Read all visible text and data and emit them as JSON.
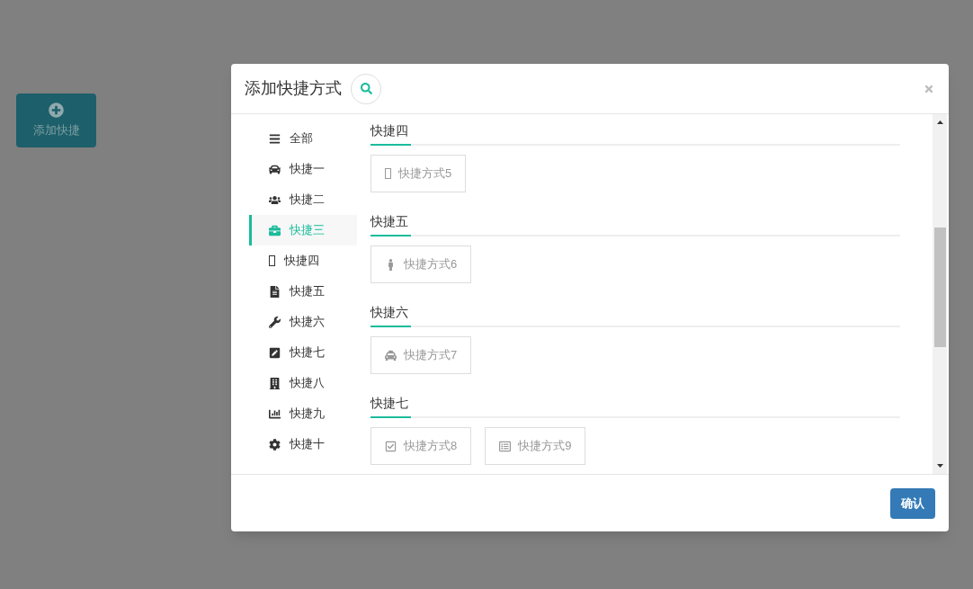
{
  "add_button": {
    "label": "添加快捷"
  },
  "dialog": {
    "title": "添加快捷方式",
    "sidebar": {
      "items": [
        {
          "label": "全部",
          "selected": false
        },
        {
          "label": "快捷一",
          "selected": false
        },
        {
          "label": "快捷二",
          "selected": false
        },
        {
          "label": "快捷三",
          "selected": true
        },
        {
          "label": "快捷四",
          "selected": false
        },
        {
          "label": "快捷五",
          "selected": false
        },
        {
          "label": "快捷六",
          "selected": false
        },
        {
          "label": "快捷七",
          "selected": false
        },
        {
          "label": "快捷八",
          "selected": false
        },
        {
          "label": "快捷九",
          "selected": false
        },
        {
          "label": "快捷十",
          "selected": false
        }
      ]
    },
    "sections": [
      {
        "title": "快捷四",
        "items": [
          {
            "label": "快捷方式5"
          }
        ]
      },
      {
        "title": "快捷五",
        "items": [
          {
            "label": "快捷方式6"
          }
        ]
      },
      {
        "title": "快捷六",
        "items": [
          {
            "label": "快捷方式7"
          }
        ]
      },
      {
        "title": "快捷七",
        "items": [
          {
            "label": "快捷方式8"
          },
          {
            "label": "快捷方式9"
          }
        ]
      }
    ],
    "confirm_button": "确认"
  }
}
